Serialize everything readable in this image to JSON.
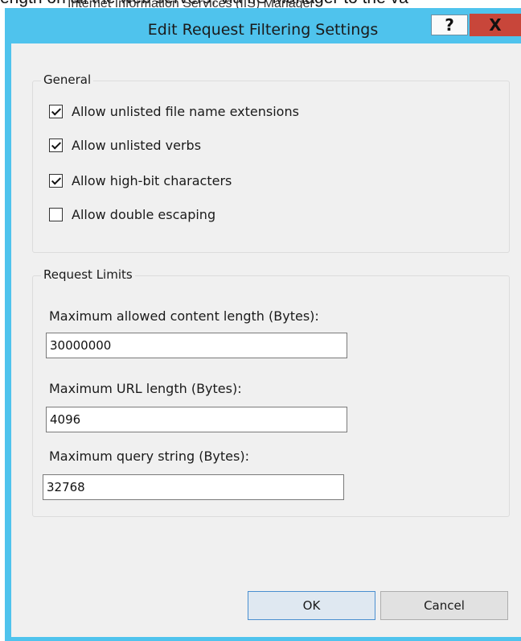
{
  "background": {
    "line1": "ength on all the web servers, via IIS Manager to the va",
    "line2": "Internet Information Services (IIS) Manager"
  },
  "dialog": {
    "title": "Edit Request Filtering Settings",
    "help_label": "?",
    "close_label": "X",
    "accent_color": "#4fc3ed"
  },
  "general": {
    "legend": "General",
    "options": [
      {
        "label": "Allow unlisted file name extensions",
        "checked": true
      },
      {
        "label": "Allow unlisted verbs",
        "checked": true
      },
      {
        "label": "Allow high-bit characters",
        "checked": true
      },
      {
        "label": "Allow double escaping",
        "checked": false
      }
    ]
  },
  "request_limits": {
    "legend": "Request Limits",
    "fields": [
      {
        "label": "Maximum allowed content length (Bytes):",
        "value": "30000000"
      },
      {
        "label": "Maximum URL length (Bytes):",
        "value": "4096"
      },
      {
        "label": "Maximum query string (Bytes):",
        "value": "32768"
      }
    ]
  },
  "buttons": {
    "ok": "OK",
    "cancel": "Cancel"
  }
}
